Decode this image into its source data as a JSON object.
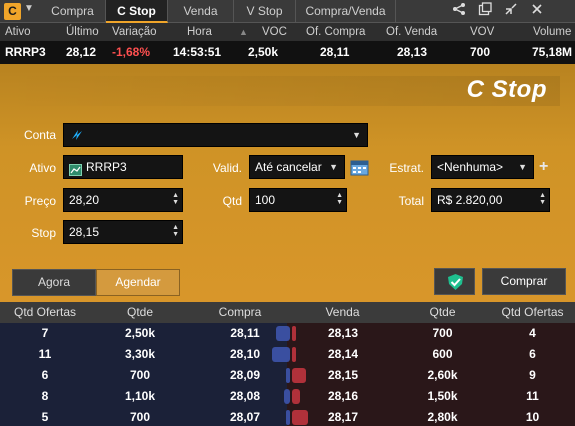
{
  "app": {
    "logo": "C",
    "colors": {
      "accent": "#f0a52a",
      "negative": "#ff5050",
      "buy_bar": "#3a4fa0",
      "sell_bar": "#b0313a"
    }
  },
  "tabs": [
    {
      "label": "Compra",
      "active": false
    },
    {
      "label": "C Stop",
      "active": true
    },
    {
      "label": "Venda",
      "active": false
    },
    {
      "label": "V Stop",
      "active": false
    },
    {
      "label": "Compra/Venda",
      "active": false
    }
  ],
  "toolbar_icons": [
    "share-icon",
    "popout-icon",
    "collapse-icon",
    "close-icon"
  ],
  "quote": {
    "headers": {
      "ativo": "Ativo",
      "ultimo": "Último",
      "variacao": "Variação",
      "hora": "Hora",
      "voc": "VOC",
      "of_compra": "Of. Compra",
      "of_venda": "Of. Venda",
      "vov": "VOV",
      "volume": "Volume"
    },
    "values": {
      "ativo": "RRRP3",
      "ultimo": "28,12",
      "variacao": "-1,68%",
      "hora": "14:53:51",
      "voc": "2,50k",
      "of_compra": "28,11",
      "of_venda": "28,13",
      "vov": "700",
      "volume": "75,18M"
    }
  },
  "order": {
    "title": "C Stop",
    "labels": {
      "conta": "Conta",
      "ativo": "Ativo",
      "valid": "Valid.",
      "estrat": "Estrat.",
      "preco": "Preço",
      "qtd": "Qtd",
      "total": "Total",
      "stop": "Stop"
    },
    "conta_value": "",
    "ativo_value": "RRRP3",
    "valid_value": "Até cancelar",
    "estrat_value": "<Nenhuma>",
    "preco_value": "28,20",
    "qtd_value": "100",
    "total_value": "R$ 2.820,00",
    "stop_value": "28,15",
    "buttons": {
      "agora": "Agora",
      "agendar": "Agendar",
      "comprar": "Comprar"
    }
  },
  "book": {
    "headers": [
      "Qtd Ofertas",
      "Qtde",
      "Compra",
      "Venda",
      "Qtde",
      "Qtd Ofertas"
    ],
    "rows": [
      {
        "buy_ofertas": "7",
        "buy_qtde": "2,50k",
        "buy_price": "28,11",
        "sell_price": "28,13",
        "sell_qtde": "700",
        "sell_ofertas": "4",
        "buy_bar": 0.35,
        "sell_bar": 0.1
      },
      {
        "buy_ofertas": "11",
        "buy_qtde": "3,30k",
        "buy_price": "28,10",
        "sell_price": "28,14",
        "sell_qtde": "600",
        "sell_ofertas": "6",
        "buy_bar": 0.46,
        "sell_bar": 0.08
      },
      {
        "buy_ofertas": "6",
        "buy_qtde": "700",
        "buy_price": "28,09",
        "sell_price": "28,15",
        "sell_qtde": "2,60k",
        "sell_ofertas": "9",
        "buy_bar": 0.1,
        "sell_bar": 0.36
      },
      {
        "buy_ofertas": "8",
        "buy_qtde": "1,10k",
        "buy_price": "28,08",
        "sell_price": "28,16",
        "sell_qtde": "1,50k",
        "sell_ofertas": "11",
        "buy_bar": 0.15,
        "sell_bar": 0.21
      },
      {
        "buy_ofertas": "5",
        "buy_qtde": "700",
        "buy_price": "28,07",
        "sell_price": "28,17",
        "sell_qtde": "2,80k",
        "sell_ofertas": "10",
        "buy_bar": 0.1,
        "sell_bar": 0.39
      }
    ]
  }
}
